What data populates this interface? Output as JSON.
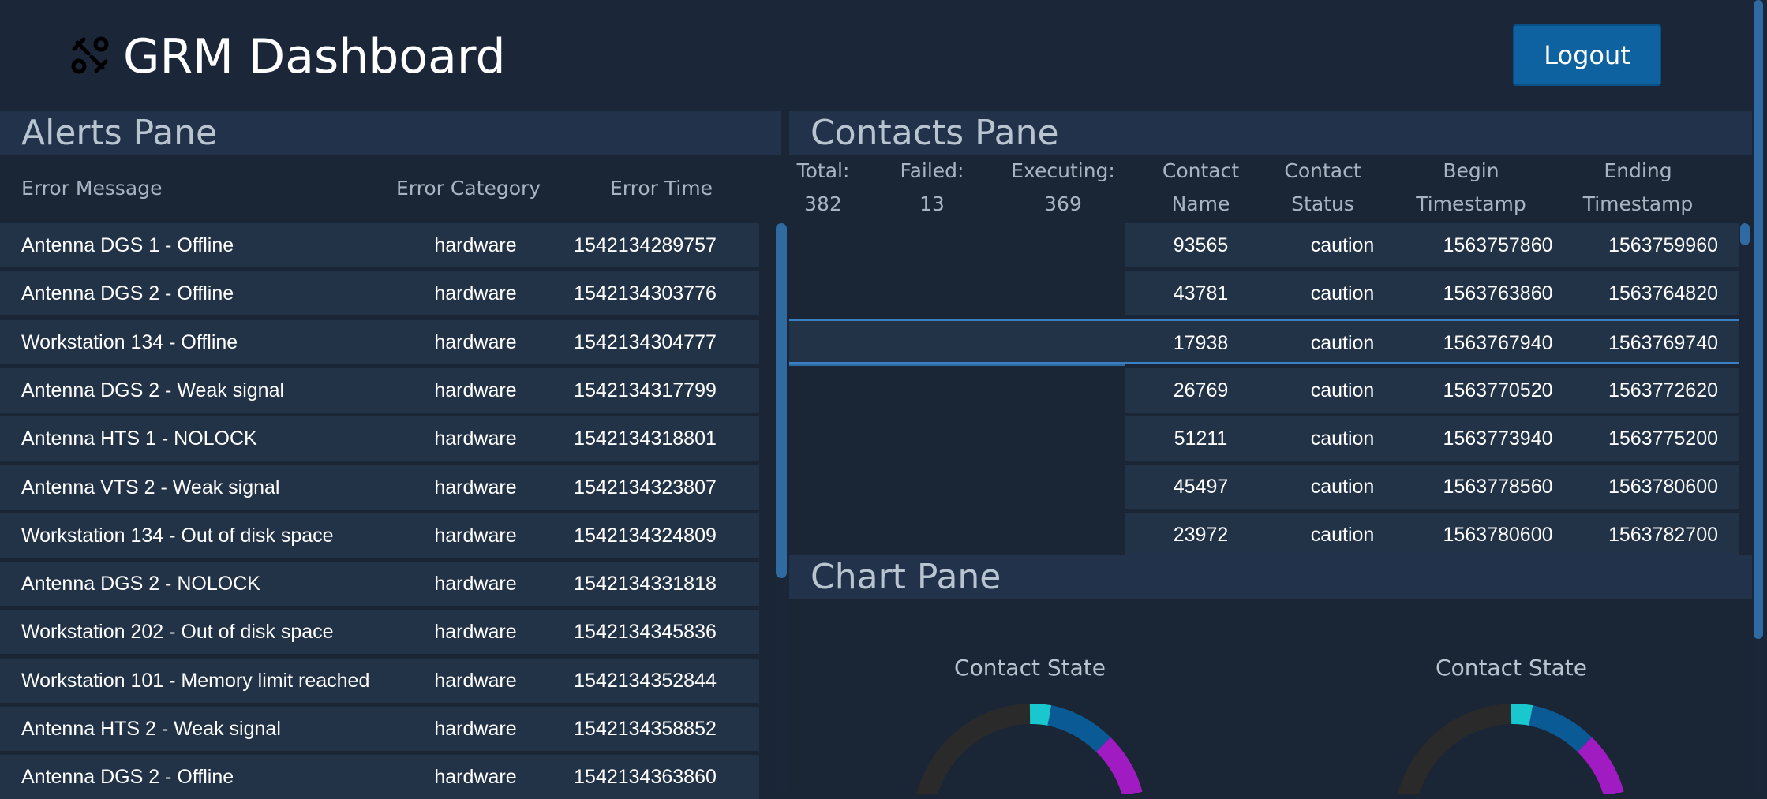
{
  "app": {
    "title": "GRM Dashboard",
    "logout_label": "Logout"
  },
  "alerts": {
    "title": "Alerts Pane",
    "columns": [
      "Error Message",
      "Error Category",
      "Error Time"
    ],
    "rows": [
      {
        "message": "Antenna DGS 1 - Offline",
        "category": "hardware",
        "time": "1542134289757"
      },
      {
        "message": "Antenna DGS 2 - Offline",
        "category": "hardware",
        "time": "1542134303776"
      },
      {
        "message": "Workstation 134 - Offline",
        "category": "hardware",
        "time": "1542134304777"
      },
      {
        "message": "Antenna DGS 2 - Weak signal",
        "category": "hardware",
        "time": "1542134317799"
      },
      {
        "message": "Antenna HTS 1 - NOLOCK",
        "category": "hardware",
        "time": "1542134318801"
      },
      {
        "message": "Antenna VTS 2 - Weak signal",
        "category": "hardware",
        "time": "1542134323807"
      },
      {
        "message": "Workstation 134 - Out of disk space",
        "category": "hardware",
        "time": "1542134324809"
      },
      {
        "message": "Antenna DGS 2 - NOLOCK",
        "category": "hardware",
        "time": "1542134331818"
      },
      {
        "message": "Workstation 202 - Out of disk space",
        "category": "hardware",
        "time": "1542134345836"
      },
      {
        "message": "Workstation 101 - Memory limit reached",
        "category": "hardware",
        "time": "1542134352844"
      },
      {
        "message": "Antenna HTS 2 - Weak signal",
        "category": "hardware",
        "time": "1542134358852"
      },
      {
        "message": "Antenna DGS 2 - Offline",
        "category": "hardware",
        "time": "1542134363860"
      }
    ]
  },
  "contacts": {
    "title": "Contacts Pane",
    "stats": [
      {
        "label": "Total:",
        "value": "382"
      },
      {
        "label": "Failed:",
        "value": "13"
      },
      {
        "label": "Executing:",
        "value": "369"
      }
    ],
    "columns": [
      {
        "line1": "Contact",
        "line2": "Name"
      },
      {
        "line1": "Contact",
        "line2": "Status"
      },
      {
        "line1": "Begin",
        "line2": "Timestamp"
      },
      {
        "line1": "Ending",
        "line2": "Timestamp"
      }
    ],
    "rows": [
      {
        "name": "93565",
        "status": "caution",
        "begin": "1563757860",
        "end": "1563759960"
      },
      {
        "name": "43781",
        "status": "caution",
        "begin": "1563763860",
        "end": "1563764820"
      },
      {
        "name": "17938",
        "status": "caution",
        "begin": "1563767940",
        "end": "1563769740"
      },
      {
        "name": "26769",
        "status": "caution",
        "begin": "1563770520",
        "end": "1563772620"
      },
      {
        "name": "51211",
        "status": "caution",
        "begin": "1563773940",
        "end": "1563775200"
      },
      {
        "name": "45497",
        "status": "caution",
        "begin": "1563778560",
        "end": "1563780600"
      },
      {
        "name": "23972",
        "status": "caution",
        "begin": "1563780600",
        "end": "1563782700"
      }
    ],
    "selected_index": 2
  },
  "chart": {
    "title": "Chart Pane",
    "donuts": [
      {
        "title": "Contact State"
      },
      {
        "title": "Contact State"
      }
    ],
    "segment_colors": [
      "#2a2a2a",
      "#19c7cf",
      "#0a5a96",
      "#a11bc2"
    ]
  }
}
